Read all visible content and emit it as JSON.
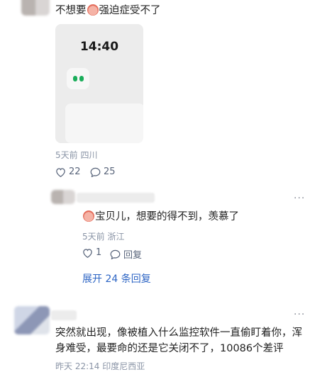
{
  "comment1": {
    "text_before": "不想要",
    "text_after": "强迫症受不了",
    "phone_time": "14:40",
    "meta": "5天前 四川",
    "likes": "22",
    "replies": "25"
  },
  "reply1": {
    "text": "宝贝儿，想要的得不到，羡慕了",
    "meta": "5天前 浙江",
    "likes": "1",
    "reply_label": "回复",
    "more": "···"
  },
  "expand_label": "展开 24 条回复",
  "comment2": {
    "line1": "突然就出现，像被植入什么监控软件一直偷盯着你，浑",
    "line2": "身难受，最要命的还是它关闭不了，10086个差评",
    "meta": "昨天 22:14 印度尼西亚",
    "more": "···"
  },
  "colors": {
    "accent_link": "#2c64c4",
    "meta_text": "#8a94a6",
    "app_green": "#1aad5a"
  },
  "icons": [
    "heart-outline-icon",
    "comment-bubble-icon",
    "more-dots-icon",
    "emoji-crying-icon"
  ]
}
